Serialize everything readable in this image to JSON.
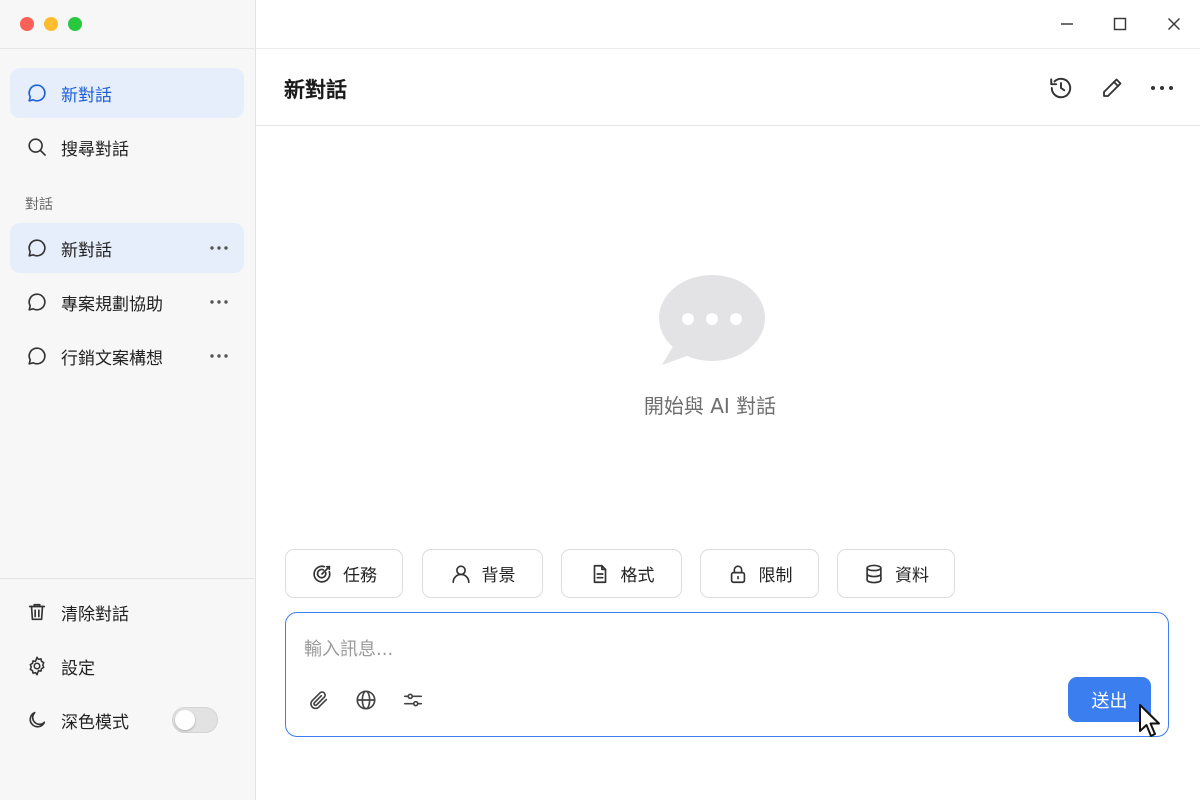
{
  "colors": {
    "accent": "#3b7ef0",
    "active_bg": "#e6eefb",
    "close": "#ff5f57",
    "minimize": "#febc2e",
    "maximize": "#28c840"
  },
  "sidebar": {
    "new_chat": {
      "label": "新對話",
      "icon": "chat-bubble-icon"
    },
    "search": {
      "label": "搜尋對話",
      "icon": "search-icon"
    },
    "section_title": "對話",
    "conversations": [
      {
        "label": "新對話",
        "active": true
      },
      {
        "label": "專案規劃協助",
        "active": false
      },
      {
        "label": "行銷文案構想",
        "active": false
      }
    ],
    "bottom": {
      "clear": {
        "label": "清除對話",
        "icon": "trash-icon"
      },
      "settings": {
        "label": "設定",
        "icon": "gear-icon"
      },
      "dark_mode": {
        "label": "深色模式",
        "icon": "moon-icon",
        "enabled": false
      }
    }
  },
  "header": {
    "title": "新對話"
  },
  "empty_state": {
    "text": "開始與 AI 對話"
  },
  "chips": [
    {
      "label": "任務",
      "icon": "target-icon"
    },
    {
      "label": "背景",
      "icon": "person-icon"
    },
    {
      "label": "格式",
      "icon": "document-icon"
    },
    {
      "label": "限制",
      "icon": "lock-icon"
    },
    {
      "label": "資料",
      "icon": "database-icon"
    }
  ],
  "composer": {
    "placeholder": "輸入訊息...",
    "send_label": "送出"
  }
}
